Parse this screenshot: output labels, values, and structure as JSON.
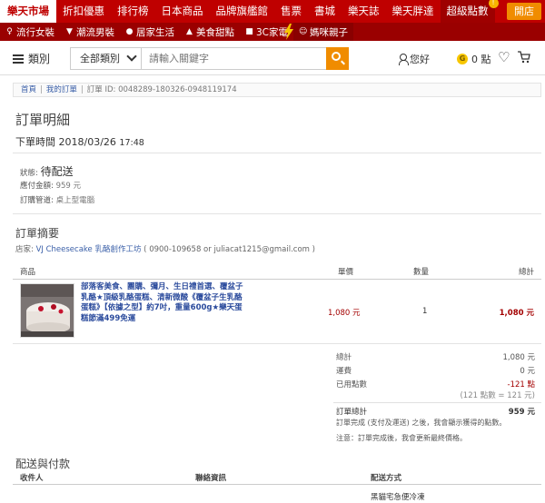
{
  "topnav": {
    "items": [
      "樂天市場",
      "折扣優惠",
      "排行榜",
      "日本商品",
      "品牌旗艦館",
      "售票",
      "書城",
      "樂天誌",
      "樂天胖達",
      "超級點數"
    ],
    "open_shop": "開店",
    "badge": "!"
  },
  "subnav": {
    "items": [
      {
        "label": "流行女裝",
        "icon": "dress-icon"
      },
      {
        "label": "潮流男裝",
        "icon": "shirt-icon"
      },
      {
        "label": "居家生活",
        "icon": "bulb-icon"
      },
      {
        "label": "美食甜點",
        "icon": "cake-icon"
      },
      {
        "label": "3C家電",
        "icon": "device-icon"
      },
      {
        "label": "媽咪親子",
        "icon": "baby-icon"
      }
    ]
  },
  "header": {
    "menu_label": "類別",
    "category": "全部類別",
    "search_placeholder": "請輸入關鍵字",
    "user_label": "您好",
    "coin_label": "G",
    "points_label": "0 點"
  },
  "breadcrumb": {
    "home": "首頁",
    "orders": "我的訂單",
    "order_id": "訂單 ID: 0048289-180326-0948119174"
  },
  "page": {
    "title": "訂單明細",
    "order_time_label": "下單時間 2018/03/26",
    "order_time_clock": "17:48"
  },
  "summary_info": {
    "status_label": "狀態:",
    "status_value": "待配送",
    "amount_label": "應付金額:",
    "amount_value": "959 元",
    "channel_label": "訂購管道:",
    "channel_value": "桌上型電腦"
  },
  "order_summary": {
    "title": "訂單摘要",
    "store_prefix": "店家: ",
    "store_name": "VJ Cheesecake 乳酪創作工坊",
    "store_contact": " ( 0900-109658 or juliacat1215@gmail.com )"
  },
  "table": {
    "headers": {
      "product": "商品",
      "price": "單價",
      "qty": "數量",
      "total": "總計"
    },
    "rows": [
      {
        "name": "部落客美食、團購、彌月、生日禮首選、覆盆子乳酪★頂級乳酪蛋糕、清新微酸《覆盆子生乳酪蛋糕》【依據之型】約7吋，重量600g★樂天蛋糕節滿499免運",
        "price": "1,080 元",
        "qty": "1",
        "total": "1,080 元"
      }
    ]
  },
  "totals": {
    "subtotal_label": "總計",
    "subtotal_value": "1,080 元",
    "shipping_label": "運費",
    "shipping_value": "0 元",
    "points_label": "已用點數",
    "points_value": "-121 點",
    "points_note": "(121 點數 = 121 元)",
    "grand_label": "訂單總計",
    "grand_value": "959 元",
    "note1": "訂單完成 (支付及運送) 之後，我會顯示獲得的點數。",
    "note2": "注意：訂單完成後，我會更新最終價格。"
  },
  "shipping": {
    "title": "配送與付款",
    "col_recipient": "收件人",
    "col_contact": "聯絡資訊",
    "col_method": "配送方式",
    "method_value": "黑貓宅急便冷凍"
  }
}
